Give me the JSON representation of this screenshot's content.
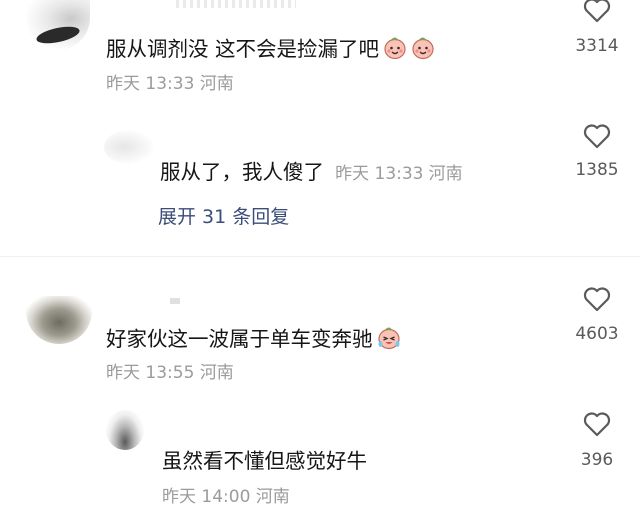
{
  "comments": [
    {
      "text": "服从调剂没  这不会是捡漏了吧",
      "emojis": [
        "peach-smile-emoji",
        "peach-smile-emoji"
      ],
      "time": "昨天 13:33",
      "location": "河南",
      "likes": "3314"
    },
    {
      "text": "服从了，我人傻了",
      "time": "昨天 13:33",
      "location": "河南",
      "likes": "1385",
      "expand_label": "展开 31 条回复"
    },
    {
      "text": "好家伙这一波属于单车变奔驰",
      "emojis": [
        "crying-laughing-peach-emoji"
      ],
      "time": "昨天 13:55",
      "location": "河南",
      "likes": "4603"
    },
    {
      "text": "虽然看不懂但感觉好牛",
      "time": "昨天 14:00",
      "location": "河南",
      "likes": "396"
    }
  ],
  "colors": {
    "text": "#161616",
    "meta": "#9b9b9b",
    "expand": "#3c4d7a",
    "peach": "#f7b3a8"
  },
  "icons": [
    "heart-outline-icon"
  ]
}
